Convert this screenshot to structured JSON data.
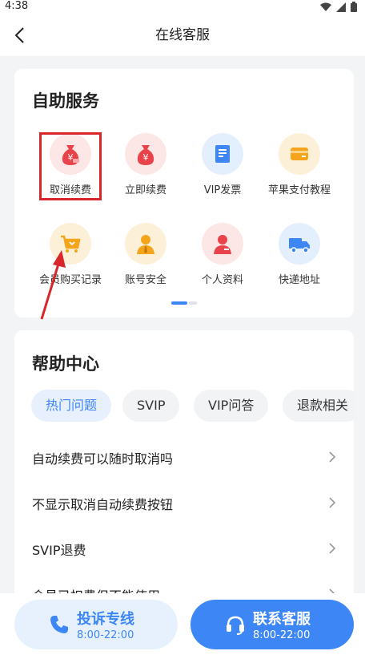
{
  "status_bar": {
    "time": "4:38"
  },
  "nav": {
    "title": "在线客服"
  },
  "self_service": {
    "title": "自助服务",
    "items": [
      {
        "label": "取消续费",
        "icon": "money-bag-icon"
      },
      {
        "label": "立即续费",
        "icon": "money-bag-icon"
      },
      {
        "label": "VIP发票",
        "icon": "receipt-icon"
      },
      {
        "label": "苹果支付教程",
        "icon": "card-icon"
      },
      {
        "label": "会员购买记录",
        "icon": "cart-icon"
      },
      {
        "label": "账号安全",
        "icon": "person-tie-icon"
      },
      {
        "label": "个人资料",
        "icon": "person-icon"
      },
      {
        "label": "快递地址",
        "icon": "truck-icon"
      }
    ]
  },
  "help_center": {
    "title": "帮助中心",
    "tabs": [
      {
        "label": "热门问题"
      },
      {
        "label": "SVIP"
      },
      {
        "label": "VIP问答"
      },
      {
        "label": "退款相关"
      }
    ],
    "faqs": [
      {
        "text": "自动续费可以随时取消吗"
      },
      {
        "text": "不显示取消自动续费按钮"
      },
      {
        "text": "SVIP退费"
      },
      {
        "text": "会员已扣费但不能使用"
      }
    ]
  },
  "bottom": {
    "complain": {
      "title": "投诉专线",
      "hours": "8:00-22:00",
      "icon": "phone-icon"
    },
    "contact": {
      "title": "联系客服",
      "hours": "8:00-22:00",
      "icon": "headset-icon"
    }
  },
  "colors": {
    "accent": "#3d86f5",
    "highlight": "#d9262b",
    "red_icon": "#e8424a",
    "orange_icon": "#f4a51c"
  }
}
